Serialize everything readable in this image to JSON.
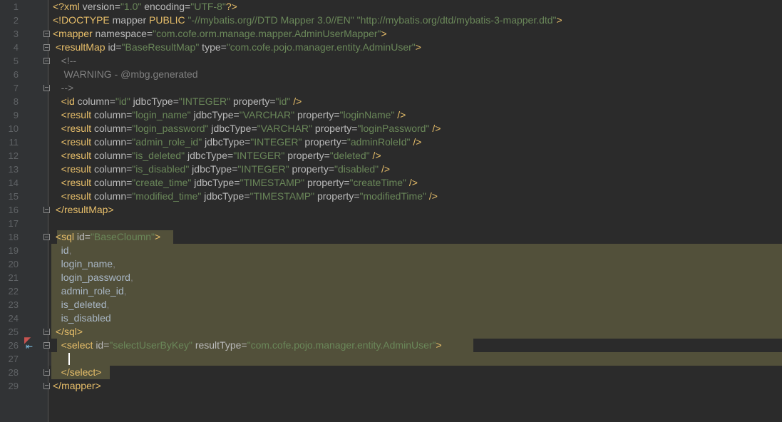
{
  "editor": {
    "lines": [
      {
        "n": "1",
        "segs": [
          {
            "c": "tag",
            "t": "<?xml "
          },
          {
            "c": "attr",
            "t": "version="
          },
          {
            "c": "val",
            "t": "\"1.0\""
          },
          {
            "c": "attr",
            "t": " encoding="
          },
          {
            "c": "val",
            "t": "\"UTF-8\""
          },
          {
            "c": "tag",
            "t": "?>"
          }
        ]
      },
      {
        "n": "2",
        "segs": [
          {
            "c": "tag",
            "t": "<!DOCTYPE "
          },
          {
            "c": "attr",
            "t": "mapper "
          },
          {
            "c": "tag",
            "t": "PUBLIC "
          },
          {
            "c": "val",
            "t": "\"-//mybatis.org//DTD Mapper 3.0//EN\""
          },
          {
            "c": "plain",
            "t": " "
          },
          {
            "c": "val",
            "t": "\"http://mybatis.org/dtd/mybatis-3-mapper.dtd\""
          },
          {
            "c": "tag",
            "t": ">"
          }
        ]
      },
      {
        "n": "3",
        "segs": [
          {
            "c": "tag",
            "t": "<mapper "
          },
          {
            "c": "attr",
            "t": "namespace="
          },
          {
            "c": "val",
            "t": "\"com.cofe.orm.manage.mapper.AdminUserMapper\""
          },
          {
            "c": "tag",
            "t": ">"
          }
        ]
      },
      {
        "n": "4",
        "segs": [
          {
            "c": "plain",
            "t": " "
          },
          {
            "c": "tag",
            "t": "<resultMap "
          },
          {
            "c": "attr",
            "t": "id="
          },
          {
            "c": "val",
            "t": "\"BaseResultMap\""
          },
          {
            "c": "attr",
            "t": " type="
          },
          {
            "c": "val",
            "t": "\"com.cofe.pojo.manager.entity.AdminUser\""
          },
          {
            "c": "tag",
            "t": ">"
          }
        ]
      },
      {
        "n": "5",
        "segs": [
          {
            "c": "cm",
            "t": "   <!--"
          }
        ]
      },
      {
        "n": "6",
        "segs": [
          {
            "c": "cm",
            "t": "    WARNING - @mbg.generated"
          }
        ]
      },
      {
        "n": "7",
        "segs": [
          {
            "c": "cm",
            "t": "   -->"
          }
        ]
      },
      {
        "n": "8",
        "segs": [
          {
            "c": "plain",
            "t": "   "
          },
          {
            "c": "tag",
            "t": "<id "
          },
          {
            "c": "attr",
            "t": "column="
          },
          {
            "c": "val",
            "t": "\"id\""
          },
          {
            "c": "attr",
            "t": " jdbcType="
          },
          {
            "c": "val",
            "t": "\"INTEGER\""
          },
          {
            "c": "attr",
            "t": " property="
          },
          {
            "c": "val",
            "t": "\"id\""
          },
          {
            "c": "tag",
            "t": " />"
          }
        ]
      },
      {
        "n": "9",
        "segs": [
          {
            "c": "plain",
            "t": "   "
          },
          {
            "c": "tag",
            "t": "<result "
          },
          {
            "c": "attr",
            "t": "column="
          },
          {
            "c": "val",
            "t": "\"login_name\""
          },
          {
            "c": "attr",
            "t": " jdbcType="
          },
          {
            "c": "val",
            "t": "\"VARCHAR\""
          },
          {
            "c": "attr",
            "t": " property="
          },
          {
            "c": "val",
            "t": "\"loginName\""
          },
          {
            "c": "tag",
            "t": " />"
          }
        ]
      },
      {
        "n": "10",
        "segs": [
          {
            "c": "plain",
            "t": "   "
          },
          {
            "c": "tag",
            "t": "<result "
          },
          {
            "c": "attr",
            "t": "column="
          },
          {
            "c": "val",
            "t": "\"login_password\""
          },
          {
            "c": "attr",
            "t": " jdbcType="
          },
          {
            "c": "val",
            "t": "\"VARCHAR\""
          },
          {
            "c": "attr",
            "t": " property="
          },
          {
            "c": "val",
            "t": "\"loginPassword\""
          },
          {
            "c": "tag",
            "t": " />"
          }
        ]
      },
      {
        "n": "11",
        "segs": [
          {
            "c": "plain",
            "t": "   "
          },
          {
            "c": "tag",
            "t": "<result "
          },
          {
            "c": "attr",
            "t": "column="
          },
          {
            "c": "val",
            "t": "\"admin_role_id\""
          },
          {
            "c": "attr",
            "t": " jdbcType="
          },
          {
            "c": "val",
            "t": "\"INTEGER\""
          },
          {
            "c": "attr",
            "t": " property="
          },
          {
            "c": "val",
            "t": "\"adminRoleId\""
          },
          {
            "c": "tag",
            "t": " />"
          }
        ]
      },
      {
        "n": "12",
        "segs": [
          {
            "c": "plain",
            "t": "   "
          },
          {
            "c": "tag",
            "t": "<result "
          },
          {
            "c": "attr",
            "t": "column="
          },
          {
            "c": "val",
            "t": "\"is_deleted\""
          },
          {
            "c": "attr",
            "t": " jdbcType="
          },
          {
            "c": "val",
            "t": "\"INTEGER\""
          },
          {
            "c": "attr",
            "t": " property="
          },
          {
            "c": "val",
            "t": "\"deleted\""
          },
          {
            "c": "tag",
            "t": " />"
          }
        ]
      },
      {
        "n": "13",
        "segs": [
          {
            "c": "plain",
            "t": "   "
          },
          {
            "c": "tag",
            "t": "<result "
          },
          {
            "c": "attr",
            "t": "column="
          },
          {
            "c": "val",
            "t": "\"is_disabled\""
          },
          {
            "c": "attr",
            "t": " jdbcType="
          },
          {
            "c": "val",
            "t": "\"INTEGER\""
          },
          {
            "c": "attr",
            "t": " property="
          },
          {
            "c": "val",
            "t": "\"disabled\""
          },
          {
            "c": "tag",
            "t": " />"
          }
        ]
      },
      {
        "n": "14",
        "segs": [
          {
            "c": "plain",
            "t": "   "
          },
          {
            "c": "tag",
            "t": "<result "
          },
          {
            "c": "attr",
            "t": "column="
          },
          {
            "c": "val",
            "t": "\"create_time\""
          },
          {
            "c": "attr",
            "t": " jdbcType="
          },
          {
            "c": "val",
            "t": "\"TIMESTAMP\""
          },
          {
            "c": "attr",
            "t": " property="
          },
          {
            "c": "val",
            "t": "\"createTime\""
          },
          {
            "c": "tag",
            "t": " />"
          }
        ]
      },
      {
        "n": "15",
        "segs": [
          {
            "c": "plain",
            "t": "   "
          },
          {
            "c": "tag",
            "t": "<result "
          },
          {
            "c": "attr",
            "t": "column="
          },
          {
            "c": "val",
            "t": "\"modified_time\""
          },
          {
            "c": "attr",
            "t": " jdbcType="
          },
          {
            "c": "val",
            "t": "\"TIMESTAMP\""
          },
          {
            "c": "attr",
            "t": " property="
          },
          {
            "c": "val",
            "t": "\"modifiedTime\""
          },
          {
            "c": "tag",
            "t": " />"
          }
        ]
      },
      {
        "n": "16",
        "segs": [
          {
            "c": "plain",
            "t": " "
          },
          {
            "c": "tag",
            "t": "</resultMap>"
          }
        ]
      },
      {
        "n": "17",
        "segs": []
      },
      {
        "n": "18",
        "segs": [
          {
            "c": "plain",
            "t": " "
          },
          {
            "c": "tag",
            "t": "<sql "
          },
          {
            "c": "attr",
            "t": "id="
          },
          {
            "c": "val",
            "t": "\"BaseCloumn\""
          },
          {
            "c": "tag",
            "t": ">"
          }
        ]
      },
      {
        "n": "19",
        "segs": [
          {
            "c": "plain",
            "t": "   id"
          },
          {
            "c": "cm",
            "t": ","
          }
        ]
      },
      {
        "n": "20",
        "segs": [
          {
            "c": "plain",
            "t": "   login_name"
          },
          {
            "c": "cm",
            "t": ","
          }
        ]
      },
      {
        "n": "21",
        "segs": [
          {
            "c": "plain",
            "t": "   login_password"
          },
          {
            "c": "cm",
            "t": ","
          }
        ]
      },
      {
        "n": "22",
        "segs": [
          {
            "c": "plain",
            "t": "   admin_role_id"
          },
          {
            "c": "cm",
            "t": ","
          }
        ]
      },
      {
        "n": "23",
        "segs": [
          {
            "c": "plain",
            "t": "   is_deleted"
          },
          {
            "c": "cm",
            "t": ","
          }
        ]
      },
      {
        "n": "24",
        "segs": [
          {
            "c": "plain",
            "t": "   is_disabled"
          }
        ]
      },
      {
        "n": "25",
        "segs": [
          {
            "c": "plain",
            "t": " "
          },
          {
            "c": "tag",
            "t": "</sql>"
          }
        ]
      },
      {
        "n": "26",
        "segs": [
          {
            "c": "plain",
            "t": "   "
          },
          {
            "c": "tag",
            "t": "<select "
          },
          {
            "c": "attr",
            "t": "id="
          },
          {
            "c": "val",
            "t": "\"selectUserByKey\""
          },
          {
            "c": "attr",
            "t": " resultType="
          },
          {
            "c": "val",
            "t": "\"com.cofe.pojo.manager.entity.AdminUser\""
          },
          {
            "c": "tag",
            "t": ">"
          }
        ]
      },
      {
        "n": "27",
        "segs": []
      },
      {
        "n": "28",
        "segs": [
          {
            "c": "plain",
            "t": "   "
          },
          {
            "c": "tag",
            "t": "</select>"
          }
        ]
      },
      {
        "n": "29",
        "segs": [
          {
            "c": "tag",
            "t": "</mapper>"
          }
        ]
      }
    ]
  },
  "colors": {
    "background": "#2b2b2b",
    "gutter": "#313335",
    "tag": "#e8bf6a",
    "attribute": "#bababa",
    "value": "#6a8759",
    "comment": "#808080",
    "highlight": "#52503a"
  }
}
